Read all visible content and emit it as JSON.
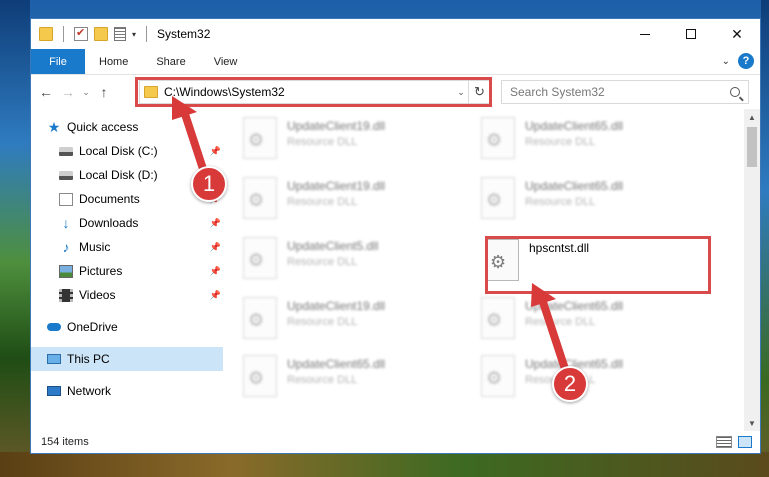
{
  "window": {
    "title": "System32",
    "controls": {
      "minimize": "minimize",
      "maximize": "maximize",
      "close": "✕"
    }
  },
  "ribbon": {
    "tabs": [
      "File",
      "Home",
      "Share",
      "View"
    ],
    "help": "?"
  },
  "nav": {
    "back": "←",
    "forward": "→",
    "recent": "⌄",
    "up": "↑",
    "address": "C:\\Windows\\System32",
    "refresh": "↻",
    "search_placeholder": "Search System32"
  },
  "sidebar": {
    "quick_access": "Quick access",
    "items": [
      {
        "label": "Local Disk (C:)",
        "icon": "disk-icon",
        "pinned": true
      },
      {
        "label": "Local Disk (D:)",
        "icon": "disk-icon",
        "pinned": false
      },
      {
        "label": "Documents",
        "icon": "documents-icon",
        "pinned": true
      },
      {
        "label": "Downloads",
        "icon": "downloads-icon",
        "pinned": true
      },
      {
        "label": "Music",
        "icon": "music-icon",
        "pinned": true
      },
      {
        "label": "Pictures",
        "icon": "pictures-icon",
        "pinned": true
      },
      {
        "label": "Videos",
        "icon": "videos-icon",
        "pinned": true
      }
    ],
    "onedrive": "OneDrive",
    "this_pc": "This PC",
    "network": "Network"
  },
  "files": [
    {
      "name": "UpdateClient19.dll",
      "type": "Resource DLL",
      "blurred": true
    },
    {
      "name": "UpdateClient65.dll",
      "type": "Resource DLL",
      "blurred": true
    },
    {
      "name": "UpdateClient19.dll",
      "type": "Resource DLL",
      "blurred": true
    },
    {
      "name": "UpdateClient65.dll",
      "type": "Resource DLL",
      "blurred": true
    },
    {
      "name": "UpdateClient5.dll",
      "type": "Resource DLL",
      "blurred": true
    },
    {
      "name": "hpscntst.dll",
      "type": "",
      "blurred": false
    },
    {
      "name": "UpdateClient19.dll",
      "type": "Resource DLL",
      "blurred": true
    },
    {
      "name": "UpdateClient65.dll",
      "type": "Resource DLL",
      "blurred": true
    },
    {
      "name": "UpdateClient65.dll",
      "type": "Resource DLL",
      "blurred": true
    },
    {
      "name": "UpdateClient65.dll",
      "type": "Resource DLL",
      "blurred": true
    }
  ],
  "status": {
    "item_count": "154 items"
  },
  "annotations": {
    "badge_1": "1",
    "badge_2": "2",
    "color": "#d83a3a"
  },
  "colors": {
    "accent": "#1979ca",
    "highlight": "#d94a4a"
  }
}
